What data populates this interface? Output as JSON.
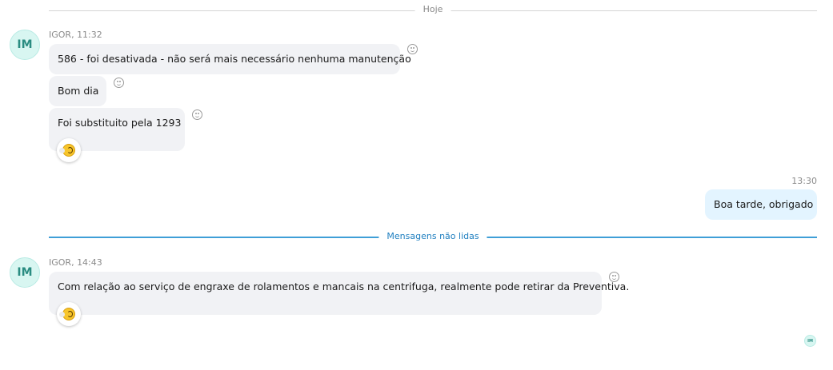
{
  "dividers": {
    "today": "Hoje",
    "unread": "Mensagens não lidas"
  },
  "groups": [
    {
      "avatar_initials": "IM",
      "sender_line": "IGOR, 11:32",
      "messages": [
        "586 - foi desativada - não será mais necessário nenhuma manutenção",
        "Bom dia",
        "Foi substituito pela 1293"
      ]
    },
    {
      "avatar_initials": "IM",
      "sender_line": "IGOR, 14:43",
      "messages": [
        "Com relação ao serviço de engraxe de rolamentos e mancais na centrifuga, realmente pode retirar da Preventiva."
      ]
    }
  ],
  "outgoing": {
    "time": "13:30",
    "message": "Boa tarde, obrigado"
  },
  "read_receipt": {
    "initials": "IM"
  },
  "icons": {
    "react": "smiley-icon",
    "reaction_shown": "laughing-emoji-icon"
  }
}
